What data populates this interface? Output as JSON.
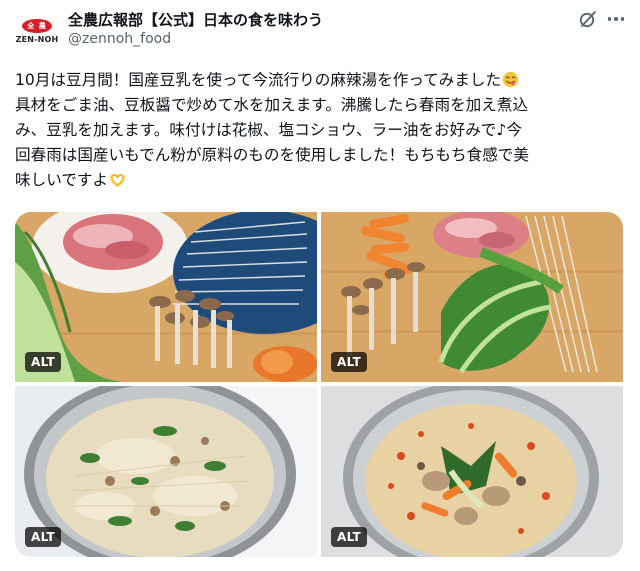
{
  "account": {
    "display_name": "全農広報部【公式】日本の食を味わう",
    "handle": "@zennoh_food",
    "avatar_badge": "全 農",
    "avatar_brand": "ZEN-NOH",
    "brand_color": "#d61f26"
  },
  "actions": {
    "grok_icon": "grok-icon",
    "more_icon": "more-icon"
  },
  "post": {
    "lines": [
      "10月は豆月間！国産豆乳を使って今流行りの麻辣湯を作ってみました",
      "具材をごま油、豆板醤で炒めて水を加えます。沸騰したら春雨を加え煮込",
      "み、豆乳を加えます。味付けは花椒、塩コショウ、ラー油をお好みで♪今",
      "回春雨は国産いもでん粉が原料のものを使用しました！もちもち食感で美",
      "味しいですよ"
    ],
    "emoji_yum": "yum-face-emoji",
    "emoji_heart": "heart-hands-emoji"
  },
  "media": {
    "alt_label": "ALT",
    "photos": [
      "raw-ingredients-photo",
      "cut-ingredients-photo",
      "soup-cooking-photo",
      "finished-mala-soup-photo"
    ]
  }
}
